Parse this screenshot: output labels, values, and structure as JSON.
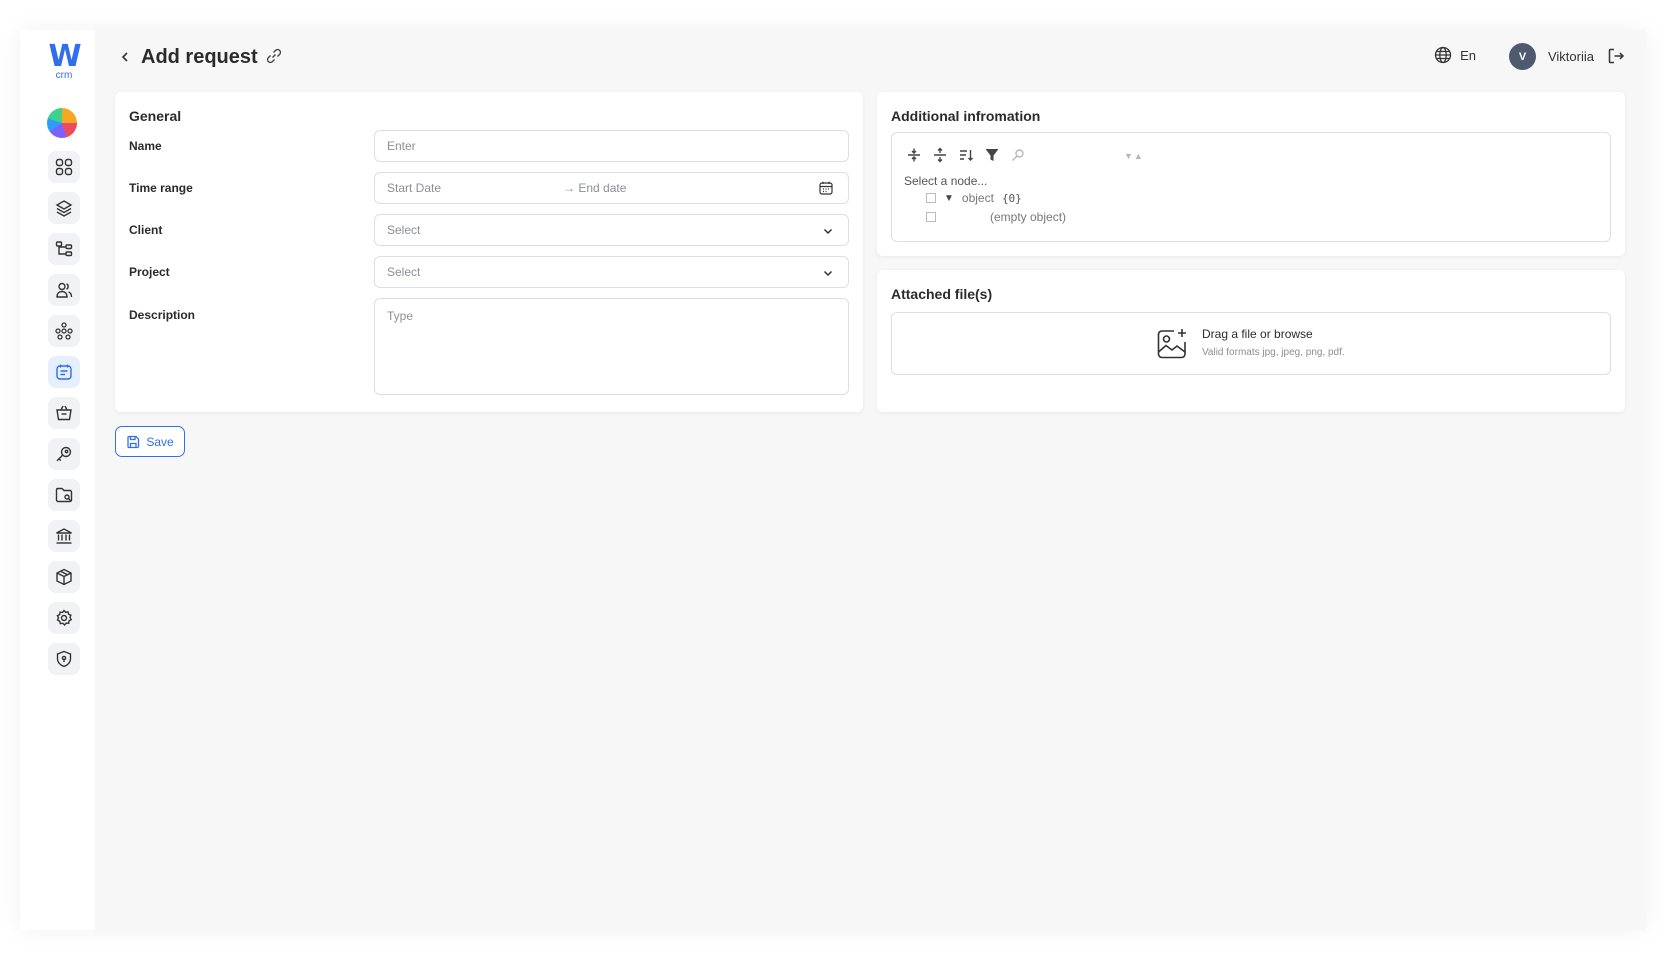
{
  "logo": {
    "mark": "W",
    "sub": "crm"
  },
  "sidebar": {
    "items": [
      {
        "icon": "dashboard-icon"
      },
      {
        "icon": "layers-icon"
      },
      {
        "icon": "hierarchy-icon"
      },
      {
        "icon": "users-icon"
      },
      {
        "icon": "network-icon"
      },
      {
        "icon": "requests-icon",
        "active": true
      },
      {
        "icon": "basket-icon"
      },
      {
        "icon": "key-icon"
      },
      {
        "icon": "folder-icon"
      },
      {
        "icon": "bank-icon"
      },
      {
        "icon": "box-icon"
      },
      {
        "icon": "settings-icon"
      },
      {
        "icon": "security-icon"
      }
    ]
  },
  "header": {
    "title": "Add request",
    "language": "En",
    "avatar_initial": "V",
    "user_name": "Viktoriia"
  },
  "general": {
    "title": "General",
    "name_label": "Name",
    "name_placeholder": "Enter",
    "time_range_label": "Time range",
    "start_placeholder": "Start Date",
    "end_placeholder": "→ End date",
    "client_label": "Client",
    "client_value": "Select",
    "project_label": "Project",
    "project_value": "Select",
    "description_label": "Description",
    "description_placeholder": "Type"
  },
  "additional": {
    "title": "Additional infromation",
    "hint": "Select a node...",
    "arrows": "▼▲",
    "root_label": "object",
    "root_count": "{0}",
    "empty_label": "(empty object)"
  },
  "files": {
    "title": "Attached file(s)",
    "drop_title": "Drag a file or browse",
    "drop_sub": "Valid formats jpg, jpeg, png, pdf."
  },
  "actions": {
    "save_label": "Save"
  },
  "colors": {
    "accent": "#2f6fec",
    "background": "#f7f7f8"
  }
}
